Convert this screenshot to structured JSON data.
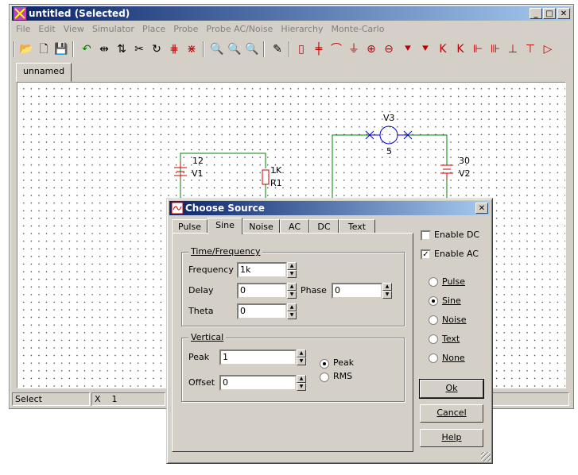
{
  "window": {
    "title": "untitled (Selected)",
    "minimize": "_",
    "maximize": "□",
    "close": "✕"
  },
  "menu": [
    "File",
    "Edit",
    "View",
    "Simulator",
    "Place",
    "Probe",
    "Probe AC/Noise",
    "Hierarchy",
    "Monte-Carlo"
  ],
  "doc_tab": "unnamed",
  "schematic": {
    "v1_value": "12",
    "v1_name": "V1",
    "r1_value": "1K",
    "r1_name": "R1",
    "v3_name": "V3",
    "v3_value": "5",
    "v2_value": "30",
    "v2_name": "V2"
  },
  "status": {
    "mode": "Select",
    "x_label": "X",
    "x_value": "1"
  },
  "dialog": {
    "title": "Choose Source",
    "close": "✕",
    "tabs": [
      "Pulse",
      "Sine",
      "Noise",
      "AC",
      "DC",
      "Text"
    ],
    "active_tab": "Sine",
    "time_group": "Time/Frequency",
    "frequency_label": "Frequency",
    "frequency_value": "1k",
    "delay_label": "Delay",
    "delay_value": "0",
    "phase_label": "Phase",
    "phase_value": "0",
    "theta_label": "Theta",
    "theta_value": "0",
    "vertical_group": "Vertical",
    "peak_label": "Peak",
    "peak_value": "1",
    "offset_label": "Offset",
    "offset_value": "0",
    "peak_radio": "Peak",
    "rms_radio": "RMS",
    "enable_dc": "Enable DC",
    "enable_ac": "Enable AC",
    "enable_dc_checked": false,
    "enable_ac_checked": true,
    "source_options": [
      "Pulse",
      "Sine",
      "Noise",
      "Text",
      "None"
    ],
    "selected_source": "Sine",
    "ok": "Ok",
    "cancel": "Cancel",
    "help": "Help"
  }
}
